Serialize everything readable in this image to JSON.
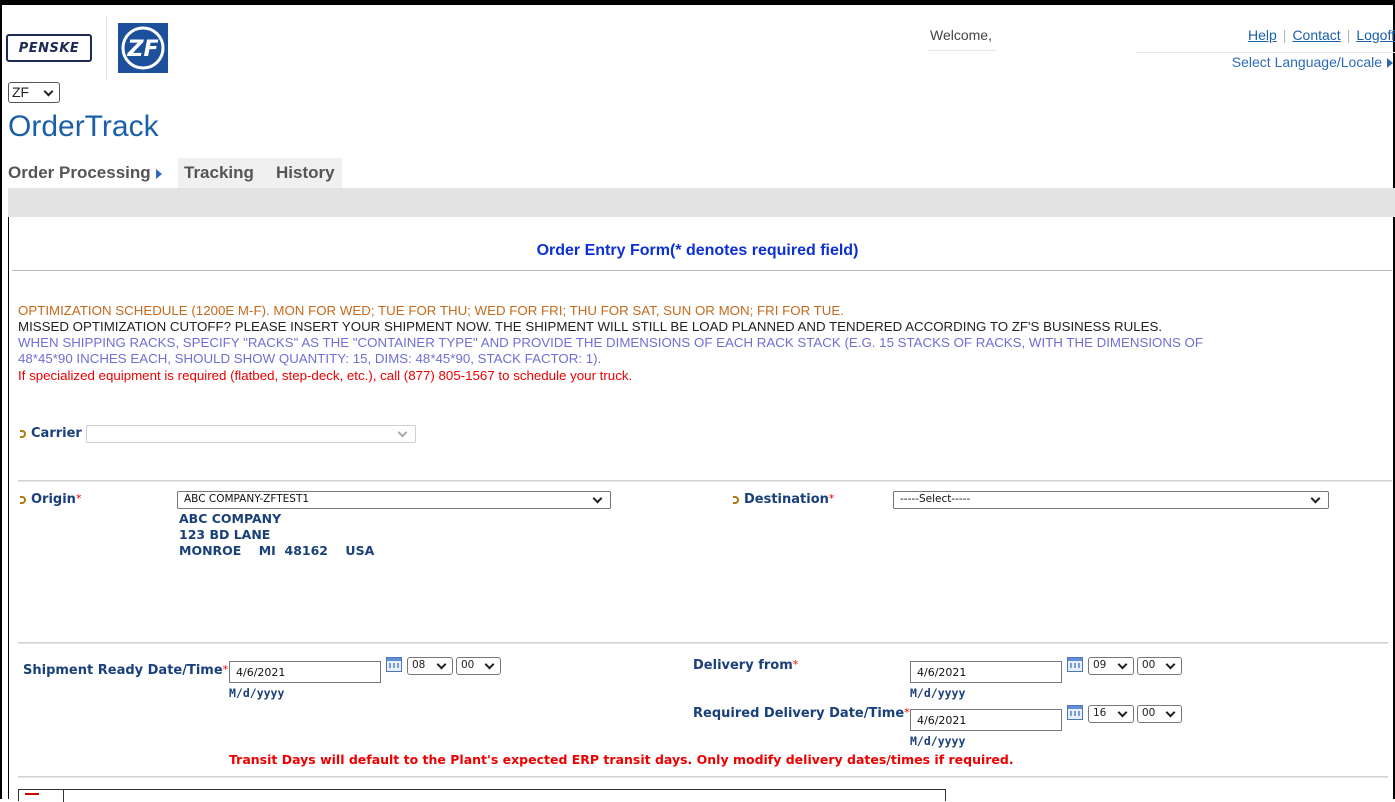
{
  "header": {
    "penske_logo_text": "PENSKE",
    "zf_logo_text": "ZF",
    "welcome": "Welcome,",
    "links": [
      "Help",
      "Contact",
      "Logoff"
    ],
    "locale_link": "Select Language/Locale",
    "company_select": "ZF"
  },
  "app_title": "OrderTrack",
  "nav": {
    "items": [
      {
        "label": "Order Processing"
      },
      {
        "label": "Tracking"
      },
      {
        "label": "History"
      }
    ]
  },
  "form": {
    "title": "Order Entry Form(* denotes required field)",
    "notices": [
      "OPTIMIZATION SCHEDULE (1200E M-F). MON FOR WED; TUE FOR THU; WED FOR FRI; THU FOR SAT, SUN OR MON; FRI FOR TUE.",
      "MISSED OPTIMIZATION CUTOFF? PLEASE INSERT YOUR SHIPMENT NOW. THE SHIPMENT WILL STILL BE LOAD PLANNED AND TENDERED ACCORDING TO ZF'S BUSINESS RULES.",
      "WHEN SHIPPING RACKS, SPECIFY \"RACKS\" AS THE \"CONTAINER TYPE\" AND PROVIDE THE DIMENSIONS OF EACH RACK STACK (E.G. 15 STACKS OF RACKS, WITH THE DIMENSIONS OF",
      "48*45*90 INCHES EACH, SHOULD SHOW QUANTITY: 15, DIMS: 48*45*90, STACK FACTOR: 1).",
      "If specialized equipment is required (flatbed, step-deck, etc.), call (877) 805-1567 to schedule your truck."
    ],
    "carrier": {
      "label": "Carrier",
      "value": ""
    },
    "origin": {
      "label": "Origin",
      "value": "ABC COMPANY-ZFTEST1",
      "address": [
        "ABC COMPANY",
        "123 BD LANE",
        "MONROE    MI  48162    USA"
      ]
    },
    "destination": {
      "label": "Destination",
      "value": "-----Select-----"
    },
    "shipment_ready": {
      "label": "Shipment Ready Date/Time",
      "date": "4/6/2021",
      "hour": "08",
      "minute": "00",
      "format": "M/d/yyyy"
    },
    "delivery_from": {
      "label": "Delivery from",
      "date": "4/6/2021",
      "hour": "09",
      "minute": "00",
      "format": "M/d/yyyy"
    },
    "required_delivery": {
      "label": "Required Delivery Date/Time",
      "date": "4/6/2021",
      "hour": "16",
      "minute": "00",
      "format": "M/d/yyyy"
    },
    "required_marker": "*",
    "transit_note": "Transit Days will default to the Plant's expected ERP transit days. Only modify delivery dates/times if required."
  }
}
